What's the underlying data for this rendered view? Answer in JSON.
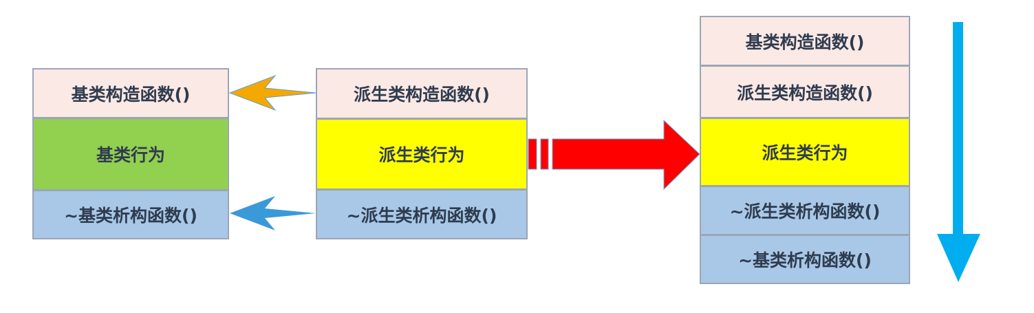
{
  "base_class": {
    "constructor": "基类构造函数()",
    "behavior": "基类行为",
    "destructor": "~基类析构函数()"
  },
  "derived_class": {
    "constructor": "派生类构造函数()",
    "behavior": "派生类行为",
    "destructor": "~派生类析构函数()"
  },
  "execution_order": [
    "基类构造函数()",
    "派生类构造函数()",
    "派生类行为",
    "~派生类析构函数()",
    "~基类析构函数()"
  ],
  "colors": {
    "constructor": "#fbe9e5",
    "base_behavior": "#92d050",
    "derived_behavior": "#ffff00",
    "destructor": "#a9c8e8",
    "constructor_arrow": "#f5a800",
    "destructor_arrow": "#3a9ad9",
    "flow_arrow": "#ff0000",
    "order_arrow": "#00aeef"
  }
}
